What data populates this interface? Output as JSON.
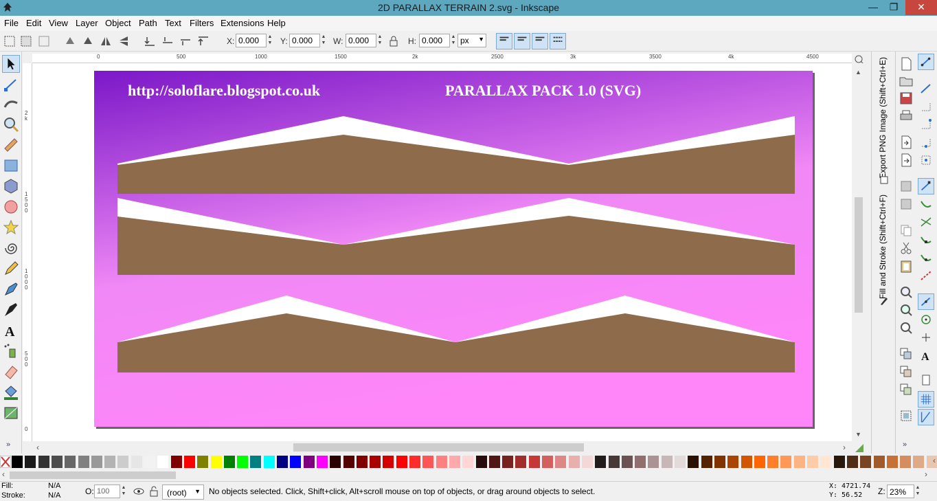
{
  "window": {
    "title": "2D PARALLAX TERRAIN 2.svg - Inkscape",
    "minimize": "—",
    "maximize": "❐",
    "close": "✕"
  },
  "menu": [
    "File",
    "Edit",
    "View",
    "Layer",
    "Object",
    "Path",
    "Text",
    "Filters",
    "Extensions",
    "Help"
  ],
  "toolbar": {
    "x_label": "X:",
    "x_value": "0.000",
    "y_label": "Y:",
    "y_value": "0.000",
    "w_label": "W:",
    "w_value": "0.000",
    "h_label": "H:",
    "h_value": "0.000",
    "unit": "px"
  },
  "ruler": {
    "ticks": [
      "0",
      "500",
      "1000",
      "1500",
      "2k",
      "2500",
      "3k",
      "3500",
      "4k",
      "4500"
    ]
  },
  "vruler": {
    "labels": [
      "2",
      "k",
      "1",
      "5",
      "0",
      "0",
      "1",
      "0",
      "0",
      "0",
      "5",
      "0",
      "0",
      "0"
    ]
  },
  "canvas": {
    "url_text": "http://soloflare.blogspot.co.uk",
    "pack_title": "PARALLAX PACK 1.0 (SVG)",
    "bg_gradient": [
      "#7b17c8",
      "#f088f6",
      "#ff86f9"
    ],
    "terrain_color": "#8d6b4b",
    "snow_color": "#ffffff"
  },
  "dock_tabs": {
    "export": "Export PNG Image (Shift+Ctrl+E)",
    "fill_stroke": "Fill and Stroke (Shift+Ctrl+F)"
  },
  "palette": {
    "colors": [
      "#000000",
      "#1a1a1a",
      "#333333",
      "#4d4d4d",
      "#666666",
      "#808080",
      "#999999",
      "#b3b3b3",
      "#cccccc",
      "#e6e6e6",
      "#f2f2f2",
      "#ffffff",
      "#800000",
      "#ff0000",
      "#808000",
      "#ffff00",
      "#008000",
      "#00ff00",
      "#008080",
      "#00ffff",
      "#000080",
      "#0000ff",
      "#800080",
      "#ff00ff",
      "#2b0000",
      "#550000",
      "#800000",
      "#aa0000",
      "#d40000",
      "#ff0000",
      "#ff2a2a",
      "#ff5555",
      "#ff8080",
      "#ffaaaa",
      "#ffd5d5",
      "#280b0b",
      "#501616",
      "#782121",
      "#a02c2c",
      "#c83737",
      "#d35f5f",
      "#de8787",
      "#e9afaf",
      "#f4d7d7",
      "#241c1c",
      "#483737",
      "#6c5353",
      "#916f6f",
      "#ac9393",
      "#c8b7b7",
      "#e3dbdb",
      "#2b1100",
      "#552200",
      "#803300",
      "#aa4400",
      "#d45500",
      "#ff6600",
      "#ff7f2a",
      "#ff9955",
      "#ffb380",
      "#ffccaa",
      "#ffe6d5",
      "#28170b",
      "#502d16",
      "#784421",
      "#a05a2c",
      "#c87137",
      "#d38d5f",
      "#deaa87",
      "#e9c6af"
    ]
  },
  "status": {
    "fill_label": "Fill:",
    "fill_value": "N/A",
    "stroke_label": "Stroke:",
    "stroke_value": "N/A",
    "opacity_label": "O:",
    "opacity_value": "100",
    "layer": "(root)",
    "message": "No objects selected. Click, Shift+click, Alt+scroll mouse on top of objects, or drag around objects to select.",
    "x_coord": "X: 4721.74",
    "y_coord": "Y:   56.52",
    "zoom_label": "Z:",
    "zoom_value": "23%"
  }
}
